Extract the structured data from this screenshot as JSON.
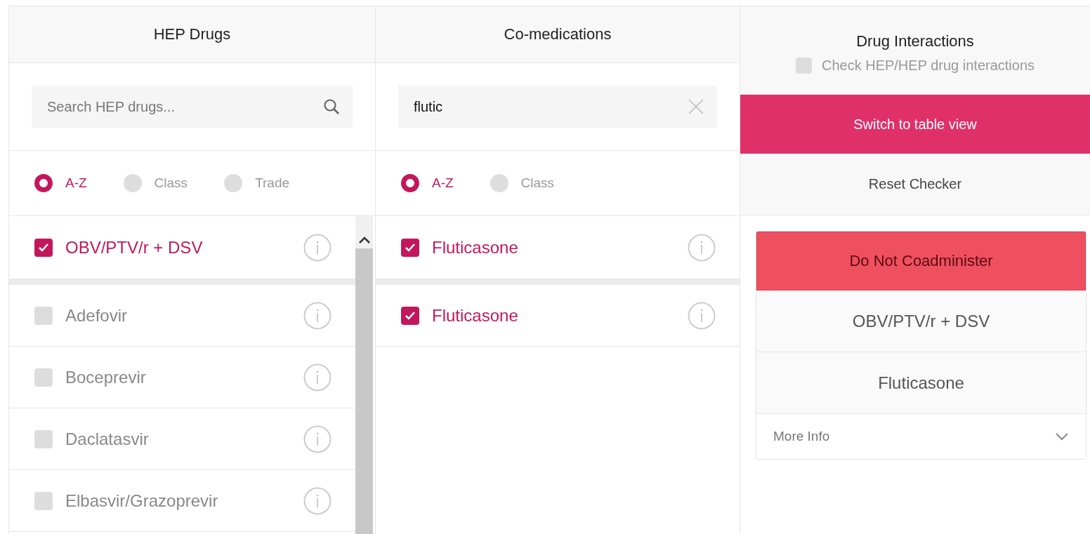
{
  "hep_drugs": {
    "title": "HEP Drugs",
    "search": {
      "placeholder": "Search HEP drugs..."
    },
    "sort_options": [
      {
        "label": "A-Z",
        "selected": true
      },
      {
        "label": "Class",
        "selected": false
      },
      {
        "label": "Trade",
        "selected": false
      }
    ],
    "selected_items": [
      {
        "name": "OBV/PTV/r + DSV",
        "checked": true
      }
    ],
    "items": [
      {
        "name": "Adefovir",
        "checked": false
      },
      {
        "name": "Boceprevir",
        "checked": false
      },
      {
        "name": "Daclatasvir",
        "checked": false
      },
      {
        "name": "Elbasvir/Grazoprevir",
        "checked": false
      }
    ]
  },
  "co_medications": {
    "title": "Co-medications",
    "search": {
      "value": "flutic"
    },
    "sort_options": [
      {
        "label": "A-Z",
        "selected": true
      },
      {
        "label": "Class",
        "selected": false
      }
    ],
    "selected_items": [
      {
        "name": "Fluticasone",
        "checked": true
      }
    ],
    "items": [
      {
        "name": "Fluticasone",
        "checked": true
      }
    ]
  },
  "drug_interactions": {
    "title": "Drug Interactions",
    "hep_hep_check": {
      "label": "Check HEP/HEP drug interactions",
      "checked": false
    },
    "switch_button": "Switch to table view",
    "reset_button": "Reset Checker",
    "result": {
      "severity": "Do Not Coadminister",
      "drugs": [
        "OBV/PTV/r + DSV",
        "Fluticasone"
      ],
      "more_info": {
        "label": "More Info",
        "expanded": false
      }
    }
  }
}
